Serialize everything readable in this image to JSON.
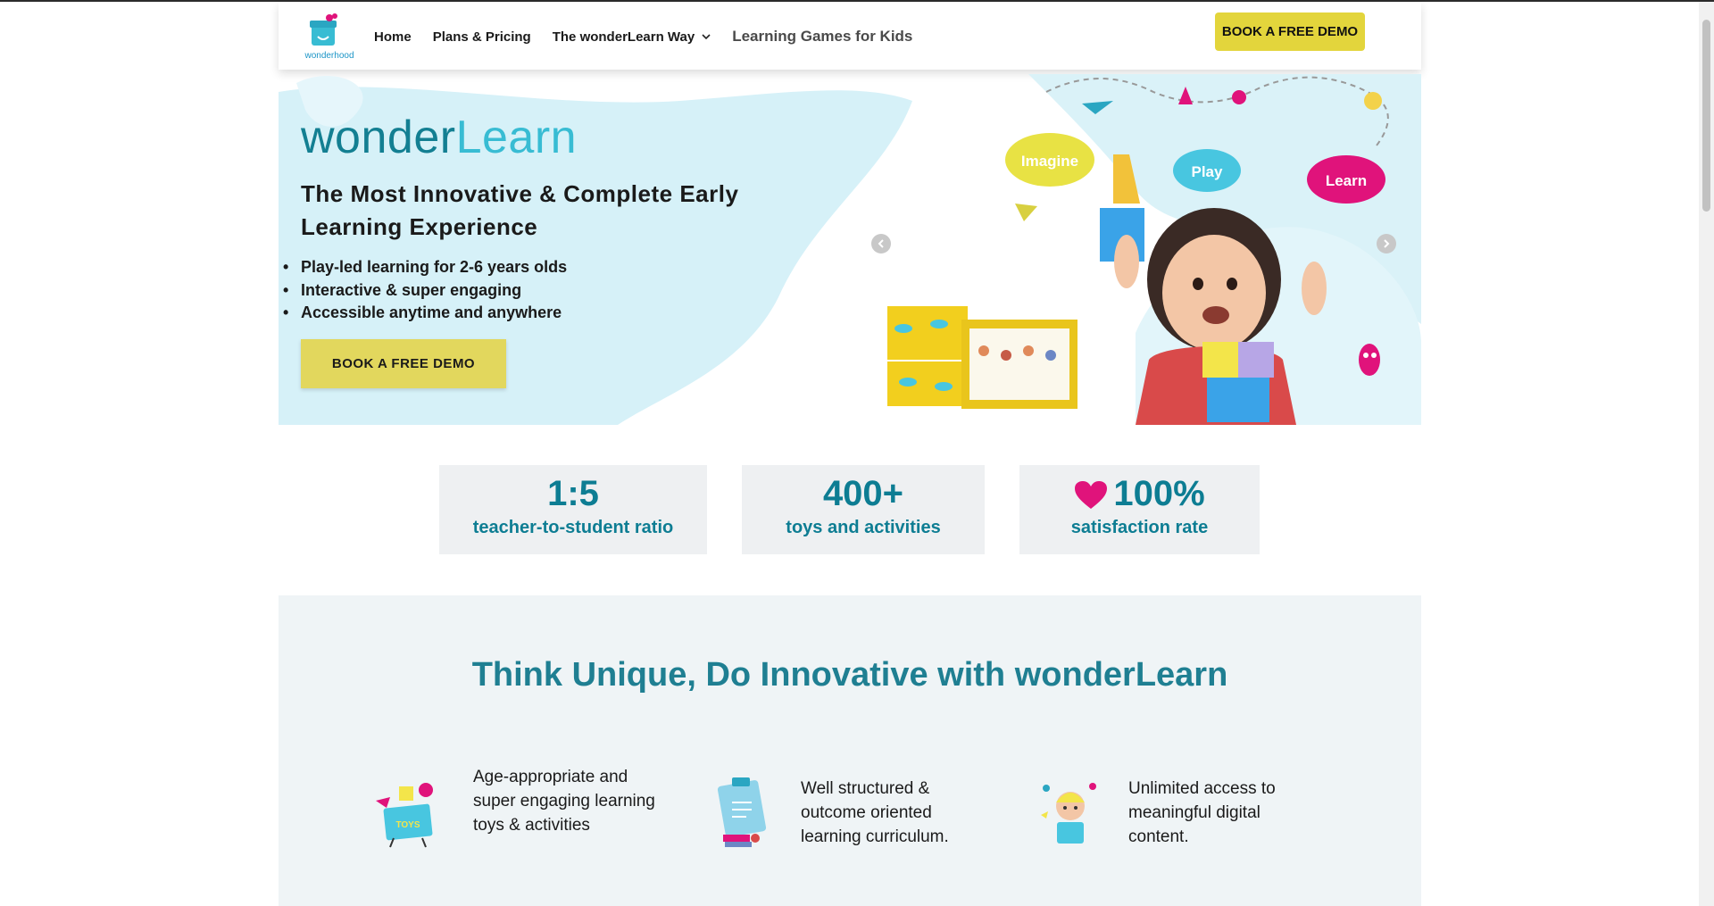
{
  "header": {
    "logo_text": "wonderhood",
    "nav": {
      "home": "Home",
      "plans": "Plans & Pricing",
      "way": "The wonderLearn Way",
      "games": "Learning Games for Kids"
    },
    "demo_button": "BOOK A FREE DEMO"
  },
  "hero": {
    "title_part1": "wonder",
    "title_part2": "Learn",
    "subtitle": "The Most Innovative & Complete Early Learning Experience",
    "bullets": [
      "Play-led learning for 2-6 years olds",
      "Interactive & super engaging",
      "Accessible anytime and anywhere"
    ],
    "demo_button": "BOOK A FREE DEMO",
    "image_clouds": [
      "Imagine",
      "Play",
      "Learn"
    ],
    "box_label": "TOYS"
  },
  "stats": [
    {
      "number": "1:5",
      "label": "teacher-to-student ratio"
    },
    {
      "number": "400+",
      "label": "toys and activities"
    },
    {
      "number": "100%",
      "label": "satisfaction rate"
    }
  ],
  "section": {
    "title": "Think Unique, Do Innovative with wonderLearn",
    "features": [
      {
        "text": "Age-appropriate and super engaging learning toys & activities",
        "icon": "toys-box-icon"
      },
      {
        "text": "Well structured & outcome oriented learning curriculum.",
        "icon": "clipboard-icon"
      },
      {
        "text": "Unlimited access to meaningful digital content.",
        "icon": "kid-laptop-icon"
      }
    ]
  },
  "colors": {
    "brand_teal": "#137f92",
    "brand_light_blue": "#38bcd3",
    "button_yellow": "#e3d53c",
    "heart_pink": "#e0137b"
  }
}
